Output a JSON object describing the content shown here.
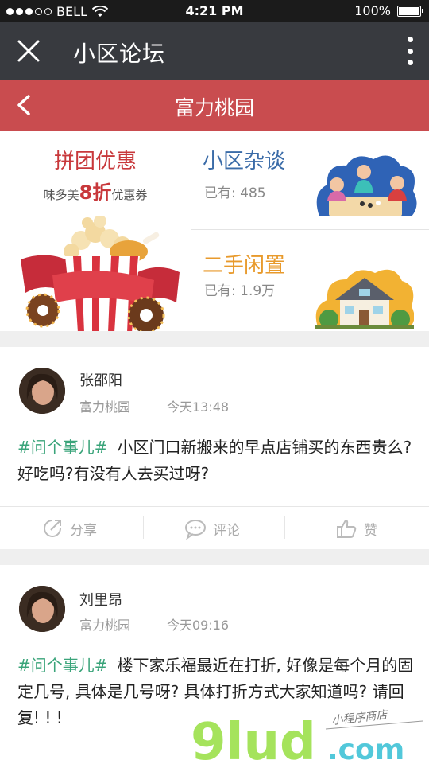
{
  "status_bar": {
    "carrier": "BELL",
    "time": "4:21 PM",
    "battery": "100%"
  },
  "app_bar": {
    "title": "小区论坛"
  },
  "community_bar": {
    "title": "富力桃园"
  },
  "promo": {
    "group_buy": {
      "title": "拼团优惠",
      "sub_prefix": "味多美",
      "sub_highlight": "8折",
      "sub_suffix": "优惠券"
    },
    "chat": {
      "title": "小区杂谈",
      "count_label": "已有: 485"
    },
    "secondhand": {
      "title": "二手闲置",
      "count_label": "已有: 1.9万"
    }
  },
  "posts": [
    {
      "author": "张邵阳",
      "community": "富力桃园",
      "time": "今天13:48",
      "tag": "#问个事儿#",
      "text": "小区门口新搬来的早点店铺买的东西贵么? 好吃吗?有没有人去买过呀?"
    },
    {
      "author": "刘里昂",
      "community": "富力桃园",
      "time": "今天09:16",
      "tag": "#问个事儿#",
      "text": "楼下家乐福最近在打折, 好像是每个月的固定几号, 具体是几号呀? 具体打折方式大家知道吗? 请回复! ! !"
    }
  ],
  "actions": {
    "share": "分享",
    "comment": "评论",
    "like": "赞"
  },
  "watermark": {
    "main": "9lud",
    "suffix": ".com",
    "sub": "小程序商店"
  },
  "colors": {
    "accent_red": "#c94c4f",
    "app_bar": "#383a3f",
    "tag_green": "#3aa47a"
  }
}
